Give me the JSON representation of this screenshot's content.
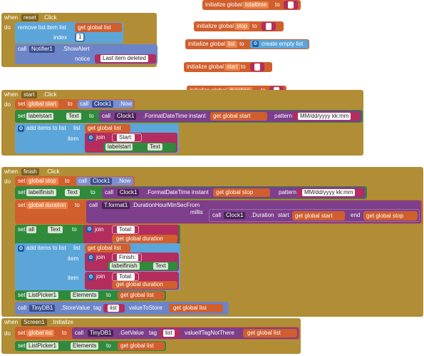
{
  "globals": {
    "label": "initialize global",
    "to": "to",
    "totaltime": "totaltime",
    "stop": "stop",
    "list": "list",
    "start": "start",
    "duration": "duration",
    "create_empty_list": "create empty list"
  },
  "reset": {
    "when": "when",
    "component": "reset",
    "event": ".Click",
    "do": "do",
    "remove": "remove list item list",
    "get_global_list": "get global list",
    "index": "index",
    "index_val": "1",
    "call": "call",
    "notifier": "Notifier1",
    "showalert": ".ShowAlert",
    "notice": "notice",
    "msg": "Last item deleted"
  },
  "start": {
    "when": "when",
    "component": "start",
    "event": ".Click",
    "do": "do",
    "set": "set",
    "global_start": "global start",
    "to": "to",
    "call": "call",
    "clock": "Clock1",
    "now": ".Now",
    "labelstart": "labelstart",
    "text": "Text",
    "format": ".FormatDateTime",
    "instant": "instant",
    "get_global_start": "get global start",
    "pattern": "pattern",
    "pattern_val": "MM/dd/yyyy kk:mm",
    "add": "add items to list",
    "list": "list",
    "get_global_list": "get global list",
    "item": "item",
    "join": "join",
    "start_str": "Start:"
  },
  "finish": {
    "when": "when",
    "component": "finish",
    "event": ".Click",
    "do": "do",
    "set": "set",
    "global_stop": "global stop",
    "to": "to",
    "call": "call",
    "clock": "Clock1",
    "now": ".Now",
    "labelfinish": "labelfinish",
    "text": "Text",
    "format": ".FormatDateTime",
    "instant": "instant",
    "get_global_stop": "get global stop",
    "pattern": "pattern",
    "pattern_val": "MM/dd/yyyy kk:mm",
    "global_duration": "global duration",
    "tformat": "T.format1",
    "durhm": ".DurationHourMinSecFrom",
    "millis": "millis",
    "duration": ".Duration",
    "start": "start",
    "get_global_start": "get global start",
    "end": "end",
    "all": "all",
    "join": "join",
    "total_str": "Total:",
    "get_global_duration": "get global duration",
    "add": "add items to list",
    "list": "list",
    "get_global_list": "get global list",
    "item": "item",
    "finish_str": "Finish:",
    "total_str2": "Total:",
    "listpicker": "ListPicker1",
    "elements": "Elements",
    "tinydb": "TinyDB1",
    "storevalue": ".StoreValue",
    "tag": "tag",
    "tag_val": "list",
    "valuetostore": "valueToStore"
  },
  "screen": {
    "when": "when",
    "component": "Screen1",
    "event": ".Initialize",
    "do": "do",
    "set": "set",
    "global_list": "global list",
    "to": "to",
    "call": "call",
    "tinydb": "TinyDB1",
    "getvalue": ".GetValue",
    "tag": "tag",
    "tag_val": "list",
    "ifnot": "valueIfTagNotThere",
    "get_global_list": "get global list",
    "listpicker": "ListPicker1",
    "elements": "Elements"
  }
}
